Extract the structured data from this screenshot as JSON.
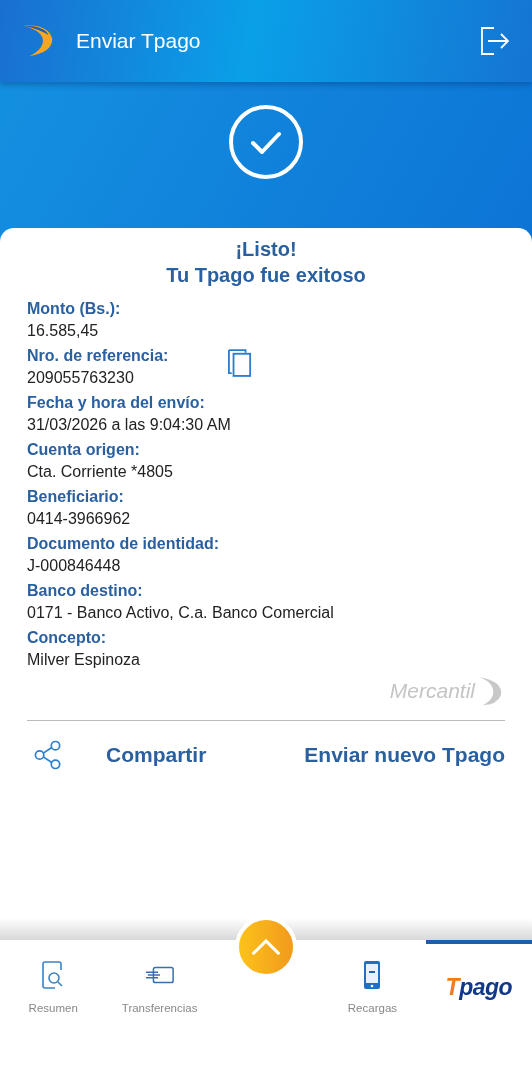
{
  "header": {
    "title": "Enviar Tpago"
  },
  "result": {
    "title": "¡Listo!",
    "subtitle": "Tu Tpago fue exitoso"
  },
  "fields": [
    {
      "label": "Monto (Bs.):",
      "value": "16.585,45",
      "copyable": false
    },
    {
      "label": "Nro. de referencia:",
      "value": "209055763230",
      "copyable": true
    },
    {
      "label": "Fecha y hora del envío:",
      "value": "31/03/2026 a las 9:04:30 AM",
      "copyable": false
    },
    {
      "label": "Cuenta origen:",
      "value": "Cta. Corriente *4805",
      "copyable": false
    },
    {
      "label": "Beneficiario:",
      "value": "0414-3966962",
      "copyable": false
    },
    {
      "label": "Documento de identidad:",
      "value": "J-000846448",
      "copyable": false
    },
    {
      "label": "Banco destino:",
      "value": "0171 - Banco Activo, C.a. Banco Comercial",
      "copyable": false
    },
    {
      "label": "Concepto:",
      "value": "Milver Espinoza",
      "copyable": false
    }
  ],
  "brand": "Mercantil",
  "actions": {
    "share": "Compartir",
    "new": "Enviar nuevo Tpago"
  },
  "tabs": [
    {
      "kind": "summary",
      "label": "Resumen",
      "selected": false
    },
    {
      "kind": "transfer",
      "label": "Transferencias",
      "selected": false
    },
    {
      "kind": "menu"
    },
    {
      "kind": "topup",
      "label": "Recargas",
      "selected": false
    },
    {
      "kind": "logo",
      "label": "Tpago",
      "selected": true
    }
  ]
}
